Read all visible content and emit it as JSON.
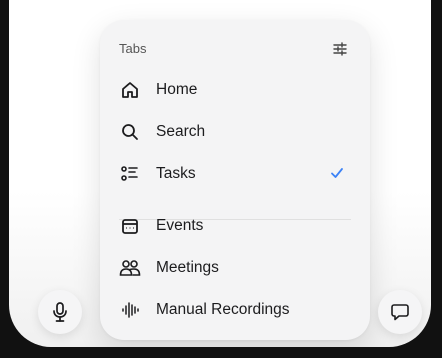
{
  "menu": {
    "title": "Tabs",
    "filter_icon": "sliders-icon",
    "items": [
      {
        "label": "Home",
        "icon": "home-icon",
        "checked": false
      },
      {
        "label": "Search",
        "icon": "search-icon",
        "checked": false
      },
      {
        "label": "Tasks",
        "icon": "tasks-list-icon",
        "checked": true
      },
      {
        "label": "Events",
        "icon": "calendar-icon",
        "checked": false
      },
      {
        "label": "Meetings",
        "icon": "people-icon",
        "checked": false
      },
      {
        "label": "Manual Recordings",
        "icon": "waveform-icon",
        "checked": false
      }
    ],
    "check_color": "#3b82f6"
  },
  "bottom_bar": {
    "left_icon": "microphone-icon",
    "right_icon": "chat-bubble-icon"
  }
}
